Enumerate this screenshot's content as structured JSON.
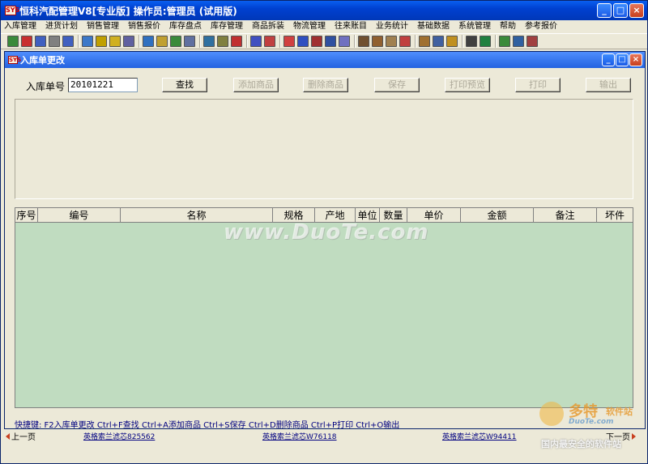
{
  "app": {
    "title": "恒科汽配管理V8[专业版] 操作员:管理员 (试用版)",
    "icon_text": "SYS"
  },
  "menu": [
    "入库管理",
    "进货计划",
    "销售管理",
    "销售报价",
    "库存盘点",
    "库存管理",
    "商品拆装",
    "物流管理",
    "往来账目",
    "业务统计",
    "基础数据",
    "系统管理",
    "帮助",
    "参考报价"
  ],
  "toolbar_colors": [
    "#3a8a3a",
    "#c83030",
    "#4060c0",
    "#808080",
    "#4060c0",
    "#3c78c8",
    "#c0a000",
    "#d0b020",
    "#6060a0",
    "#3070c0",
    "#c0a030",
    "#3a8a3a",
    "#6070a0",
    "#3070a0",
    "#808040",
    "#c03030",
    "#4050c0",
    "#c04040",
    "#d04040",
    "#3050c0",
    "#a03030",
    "#3050a0",
    "#7070c0",
    "#705030",
    "#906030",
    "#a08050",
    "#c04040",
    "#a07030",
    "#4060a0",
    "#c09020",
    "#404040",
    "#208040",
    "#3a8a3a",
    "#3060a0",
    "#a04040"
  ],
  "child_window": {
    "title": "入库单更改",
    "icon_text": "SYS"
  },
  "form": {
    "order_label": "入库单号",
    "order_value": "20101221",
    "buttons": [
      {
        "label": "查找",
        "enabled": true
      },
      {
        "label": "添加商品",
        "enabled": false
      },
      {
        "label": "删除商品",
        "enabled": false
      },
      {
        "label": "保存",
        "enabled": false
      },
      {
        "label": "打印预览",
        "enabled": false
      },
      {
        "label": "打印",
        "enabled": false
      },
      {
        "label": "输出",
        "enabled": false
      }
    ]
  },
  "grid": {
    "columns": [
      "序号",
      "编号",
      "名称",
      "规格",
      "产地",
      "单位",
      "数量",
      "单价",
      "金额",
      "备注",
      "坏件"
    ],
    "rows": []
  },
  "hotkeys": "快捷键: F2入库单更改 Ctrl+F查找 Ctrl+A添加商品 Ctrl+S保存 Ctrl+D删除商品 Ctrl+P打印 Ctrl+O输出",
  "status": {
    "prev": "上一页",
    "next": "下一页",
    "links": [
      "英格索兰滤芯825562",
      "英格索兰滤芯W76118",
      "英格索兰滤芯W94411"
    ]
  },
  "watermark": {
    "center": "www.DuoTe.com",
    "brand": "多特",
    "brand_suffix": "软件站",
    "site": "DuoTe.com",
    "slogan": "国内最安全的软件站"
  }
}
